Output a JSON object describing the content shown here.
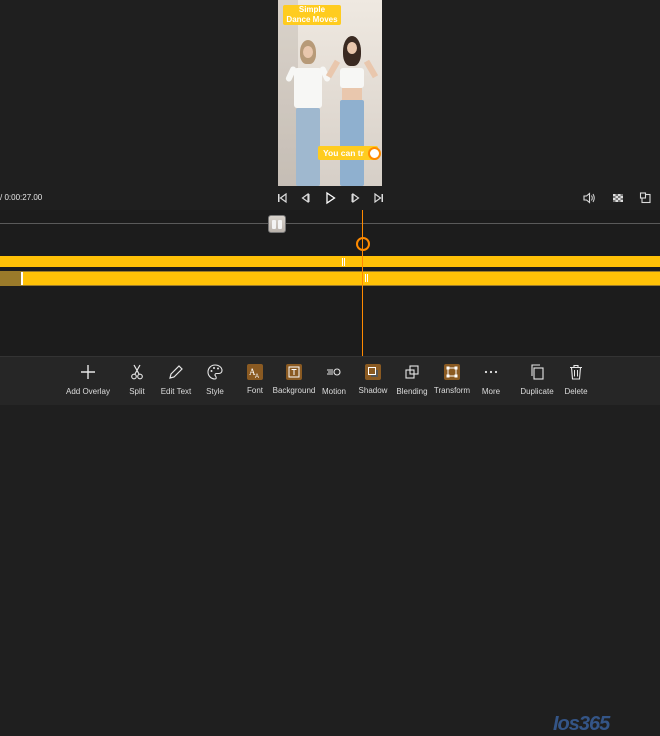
{
  "preview": {
    "title_overlay_line1": "Simple",
    "title_overlay_line2": "Dance Moves",
    "caption_overlay": "You can tr"
  },
  "playback": {
    "time": "/ 0:00:27.00"
  },
  "toolbar": {
    "items": [
      {
        "label": "Add Overlay",
        "icon": "plus-icon"
      },
      {
        "label": "Split",
        "icon": "scissors-icon"
      },
      {
        "label": "Edit Text",
        "icon": "pencil-icon"
      },
      {
        "label": "Style",
        "icon": "palette-icon"
      },
      {
        "label": "Font",
        "icon": "font-icon"
      },
      {
        "label": "Background",
        "icon": "text-box-icon"
      },
      {
        "label": "Motion",
        "icon": "motion-icon"
      },
      {
        "label": "Shadow",
        "icon": "shadow-icon"
      },
      {
        "label": "Blending",
        "icon": "blending-icon"
      },
      {
        "label": "Transform",
        "icon": "transform-icon"
      },
      {
        "label": "More",
        "icon": "more-icon"
      },
      {
        "label": "Duplicate",
        "icon": "duplicate-icon"
      },
      {
        "label": "Delete",
        "icon": "trash-icon"
      }
    ]
  },
  "watermark": "Ios365",
  "colors": {
    "accent": "#ff8a00",
    "track": "#ffc107",
    "background": "#1f1f1f"
  }
}
